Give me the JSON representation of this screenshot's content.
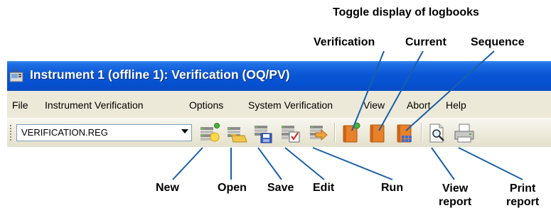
{
  "callouts": {
    "toggle_heading": "Toggle display of logbooks",
    "verification": "Verification",
    "current": "Current",
    "sequence": "Sequence",
    "new": "New",
    "open": "Open",
    "save": "Save",
    "edit": "Edit",
    "run": "Run",
    "view_report": [
      "View",
      "report"
    ],
    "print_report": [
      "Print",
      "report"
    ]
  },
  "window": {
    "title": "Instrument 1 (offline 1): Verification (OQ/PV)",
    "icon": "instrument-app-icon"
  },
  "menu": [
    "File",
    "Instrument Verification",
    "Options",
    "System Verification",
    "View",
    "Abort",
    "Help"
  ],
  "toolbar": {
    "file_select": {
      "value": "VERIFICATION.REG"
    },
    "buttons": [
      {
        "name": "new",
        "icon": "new-file-icon"
      },
      {
        "name": "open",
        "icon": "open-folder-icon"
      },
      {
        "name": "save",
        "icon": "save-disk-icon"
      },
      {
        "name": "edit",
        "icon": "edit-check-icon"
      },
      {
        "name": "run",
        "icon": "run-arrow-icon"
      },
      {
        "name": "verification-logbook",
        "icon": "logbook-verification-icon"
      },
      {
        "name": "current-logbook",
        "icon": "logbook-current-icon"
      },
      {
        "name": "sequence-logbook",
        "icon": "logbook-sequence-icon"
      },
      {
        "name": "view-report",
        "icon": "view-report-icon"
      },
      {
        "name": "print-report",
        "icon": "print-report-icon"
      }
    ]
  },
  "colors": {
    "titlebar": "#0a56d6",
    "menubar": "#ece9d8",
    "logbook": "#e8812a",
    "status_dot": "#4ab535"
  }
}
